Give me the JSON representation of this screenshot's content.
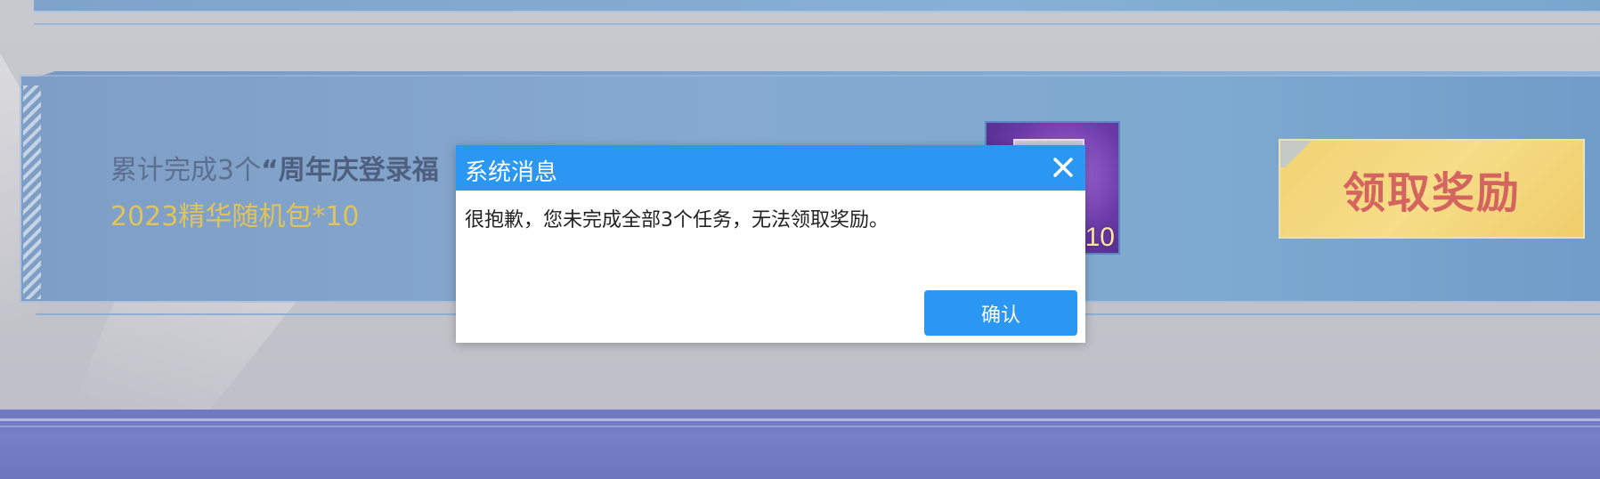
{
  "task": {
    "description_prefix": "累计完成3个",
    "description_highlight": "“周年庆登录福",
    "reward_text": "2023精华随机包*10",
    "reward_item_count": "10",
    "claim_button_label": "领取奖励"
  },
  "dialog": {
    "title": "系统消息",
    "message": "很抱歉，您未完成全部3个任务，无法领取奖励。",
    "confirm_label": "确认",
    "close_icon": "close-icon"
  },
  "colors": {
    "dialog_accent": "#2a98f2",
    "reward_text": "#e0c35a",
    "claim_button_text": "#d4645f",
    "claim_button_bg": "#f2d273"
  }
}
